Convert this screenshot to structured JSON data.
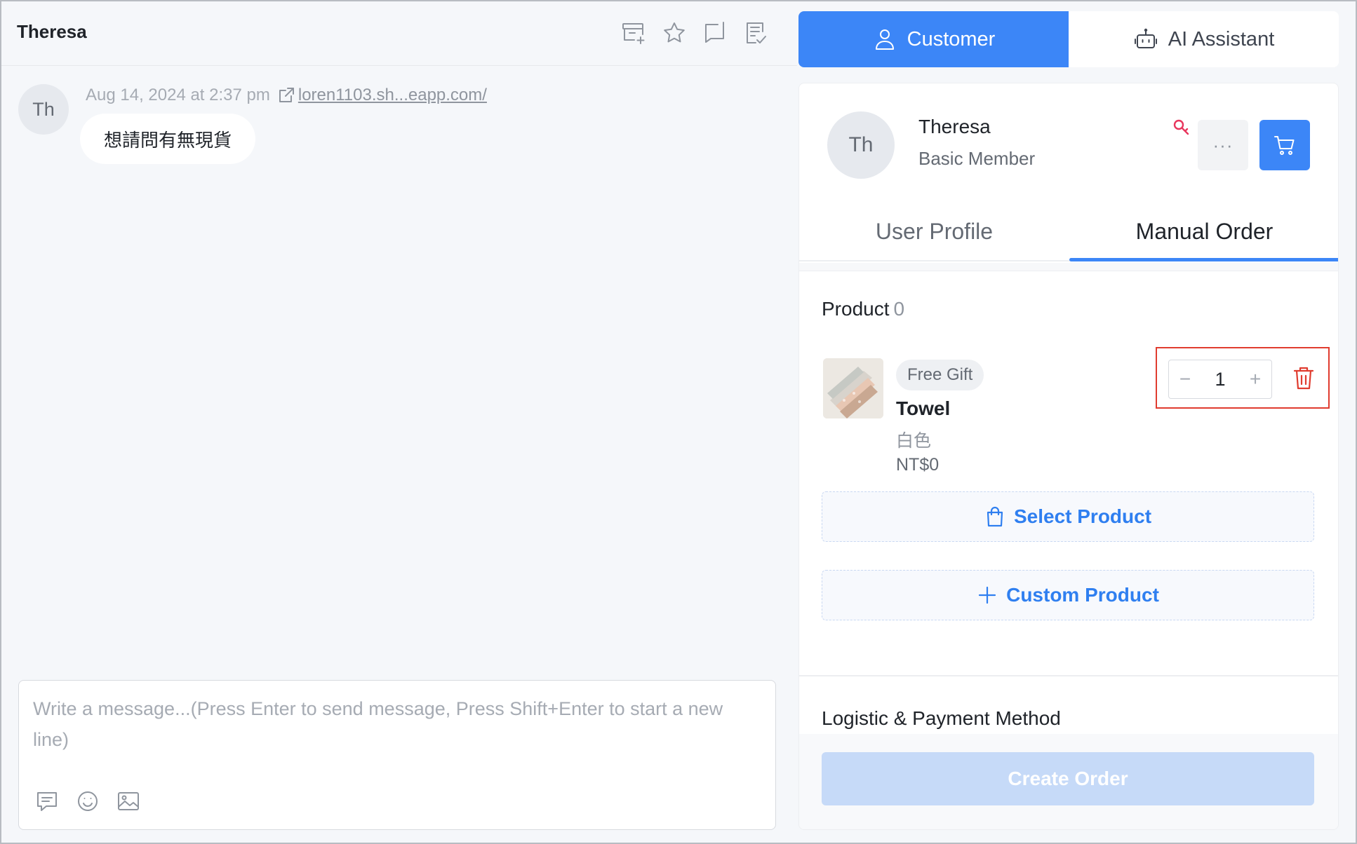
{
  "chat": {
    "title": "Theresa",
    "header_icons": [
      "archive-add-icon",
      "star-icon",
      "chat-bubble-icon",
      "note-check-icon"
    ],
    "message": {
      "avatar_initials": "Th",
      "timestamp": "Aug 14, 2024 at 2:37 pm",
      "link_text": "loren1103.sh...eapp.com/",
      "text": "想請問有無現貨"
    },
    "composer": {
      "placeholder": "Write a message...(Press Enter to send message, Press Shift+Enter to start a new line)",
      "tools": [
        "quick-reply-icon",
        "emoji-icon",
        "image-icon"
      ]
    }
  },
  "panel": {
    "segments": [
      {
        "label": "Customer",
        "icon": "user-icon",
        "active": true
      },
      {
        "label": "AI Assistant",
        "icon": "robot-icon",
        "active": false
      }
    ],
    "profile": {
      "avatar_initials": "Th",
      "name": "Theresa",
      "level": "Basic Member",
      "more_label": "···"
    },
    "tabs": [
      {
        "label": "User Profile",
        "active": false
      },
      {
        "label": "Manual Order",
        "active": true
      }
    ],
    "products": {
      "title": "Product",
      "count": "0",
      "items": [
        {
          "tag": "Free Gift",
          "name": "Towel",
          "variant": "白色",
          "price": "NT$0",
          "quantity": "1"
        }
      ],
      "select_label": "Select Product",
      "custom_label": "Custom Product"
    },
    "logistics_title": "Logistic & Payment Method",
    "create_label": "Create Order",
    "colors": {
      "accent": "#3c86f7",
      "danger": "#e03c2f",
      "disabled_button": "#c6daf8"
    }
  }
}
